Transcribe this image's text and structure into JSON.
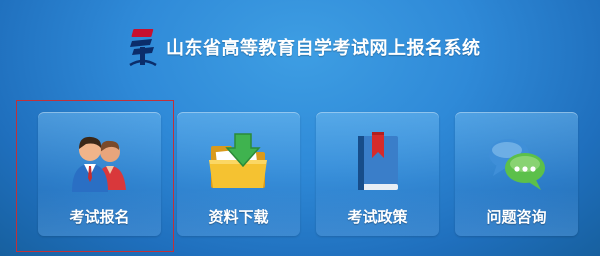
{
  "header": {
    "title": "山东省高等教育自学考试网上报名系统",
    "logo_icon": "exam-emblem-icon"
  },
  "tiles": [
    {
      "label": "考试报名",
      "icon": "users-icon",
      "selected": true
    },
    {
      "label": "资料下载",
      "icon": "folder-download-icon",
      "selected": false
    },
    {
      "label": "考试政策",
      "icon": "bookmark-book-icon",
      "selected": false
    },
    {
      "label": "问题咨询",
      "icon": "chat-bubbles-icon",
      "selected": false
    }
  ],
  "colors": {
    "background": "#2f8ad8",
    "selection_outline": "#c0313a",
    "text": "#ffffff"
  }
}
